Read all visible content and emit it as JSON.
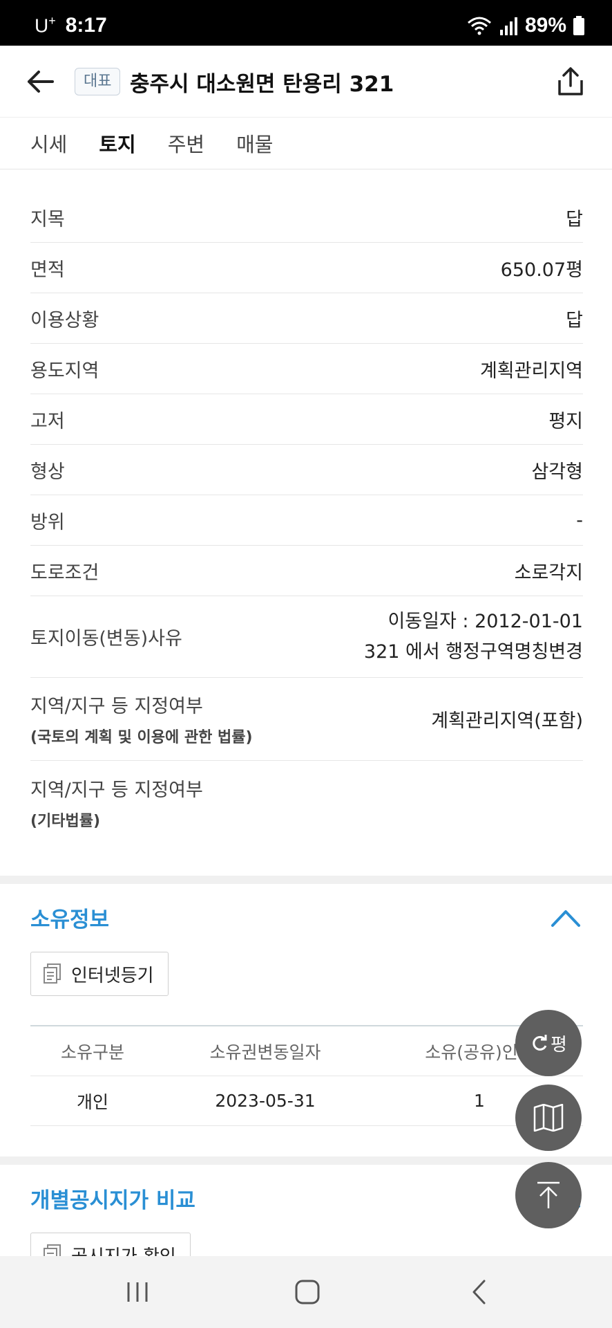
{
  "status_bar": {
    "carrier": "U",
    "carrier_sup": "+",
    "time": "8:17",
    "battery": "89%"
  },
  "header": {
    "badge": "대표",
    "title": "충주시 대소원면 탄용리 321"
  },
  "tabs": [
    {
      "label": "시세"
    },
    {
      "label": "토지"
    },
    {
      "label": "주변"
    },
    {
      "label": "매물"
    }
  ],
  "land_info": [
    {
      "label": "지목",
      "value": "답"
    },
    {
      "label": "면적",
      "value": "650.07평"
    },
    {
      "label": "이용상황",
      "value": "답"
    },
    {
      "label": "용도지역",
      "value": "계획관리지역"
    },
    {
      "label": "고저",
      "value": "평지"
    },
    {
      "label": "형상",
      "value": "삼각형"
    },
    {
      "label": "방위",
      "value": "-"
    },
    {
      "label": "도로조건",
      "value": "소로각지"
    },
    {
      "label": "토지이동(변동)사유",
      "value_line1": "이동일자 : 2012-01-01",
      "value_line2": "321 에서 행정구역명칭변경"
    },
    {
      "label": "지역/지구 등 지정여부",
      "sub": "(국토의 계획 및 이용에 관한 법률)",
      "value": "계획관리지역(포함)"
    },
    {
      "label": "지역/지구 등 지정여부",
      "sub": "(기타법률)",
      "value": ""
    }
  ],
  "ownership": {
    "title": "소유정보",
    "doc_button": "인터넷등기",
    "columns": [
      "소유구분",
      "소유권변동일자",
      "소유(공유)인수"
    ],
    "rows": [
      [
        "개인",
        "2023-05-31",
        "1"
      ]
    ]
  },
  "price_compare": {
    "title": "개별공시지가 비교",
    "doc_button": "공시지가 확인"
  },
  "fab": {
    "unit_label": "평"
  }
}
